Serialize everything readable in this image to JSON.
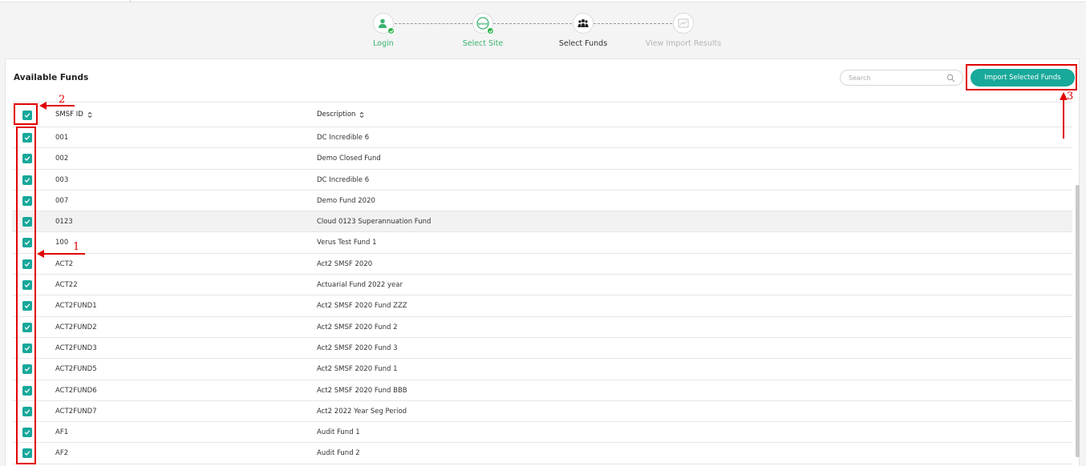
{
  "stepper": {
    "steps": [
      {
        "label": "Login",
        "state": "done",
        "icon": "user-icon"
      },
      {
        "label": "Select Site",
        "state": "done",
        "icon": "www-globe-icon"
      },
      {
        "label": "Select Funds",
        "state": "current",
        "icon": "people-group-icon"
      },
      {
        "label": "View Import Results",
        "state": "future",
        "icon": "chart-icon"
      }
    ]
  },
  "panel": {
    "title": "Available Funds",
    "search_placeholder": "Search",
    "import_label": "Import Selected Funds"
  },
  "table": {
    "columns": [
      "SMSF ID",
      "Description"
    ],
    "select_all_checked": true,
    "rows": [
      {
        "id": "001",
        "desc": "DC Incredible 6"
      },
      {
        "id": "002",
        "desc": "Demo Closed Fund"
      },
      {
        "id": "003",
        "desc": "DC Incredible 6"
      },
      {
        "id": "007",
        "desc": "Demo Fund 2020"
      },
      {
        "id": "0123",
        "desc": "Cloud 0123 Superannuation Fund"
      },
      {
        "id": "100",
        "desc": "Verus Test Fund 1"
      },
      {
        "id": "ACT2",
        "desc": "Act2 SMSF 2020"
      },
      {
        "id": "ACT22",
        "desc": "Actuarial Fund 2022 year"
      },
      {
        "id": "ACT2FUND1",
        "desc": "Act2 SMSF 2020 Fund ZZZ"
      },
      {
        "id": "ACT2FUND2",
        "desc": "Act2 SMSF 2020 Fund 2"
      },
      {
        "id": "ACT2FUND3",
        "desc": "Act2 SMSF 2020 Fund 3"
      },
      {
        "id": "ACT2FUND5",
        "desc": "Act2 SMSF 2020 Fund 1"
      },
      {
        "id": "ACT2FUND6",
        "desc": "Act2 SMSF 2020 Fund BBB"
      },
      {
        "id": "ACT2FUND7",
        "desc": "Act2 2022 Year Seg Period"
      },
      {
        "id": "AF1",
        "desc": "Audit Fund 1"
      },
      {
        "id": "AF2",
        "desc": "Audit Fund 2"
      }
    ]
  },
  "annotations": {
    "one": "1",
    "two": "2",
    "three": "3",
    "color": "#e10000"
  },
  "colors": {
    "accent": "#18a99a",
    "done": "#2db34a"
  }
}
